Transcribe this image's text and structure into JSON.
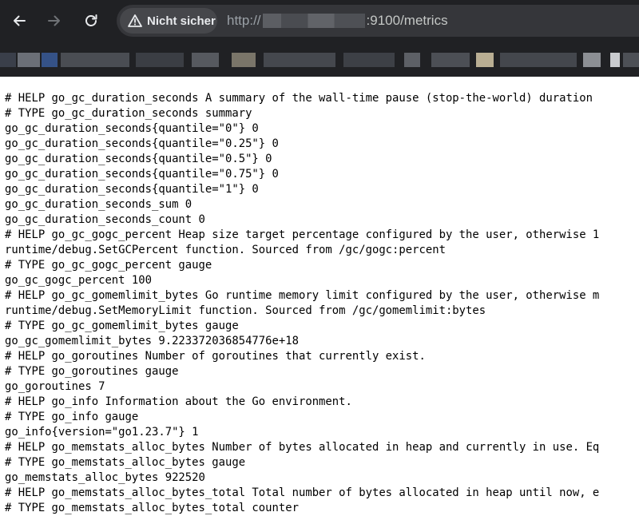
{
  "browser": {
    "security_label": "Nicht sicher",
    "url_scheme": "http://",
    "url_host": "",
    "url_path": ":9100/metrics",
    "icons": {
      "back": "arrow-left-icon",
      "forward": "arrow-right-icon",
      "reload": "reload-icon",
      "security": "warning-triangle-icon"
    }
  },
  "page": {
    "lines": [
      "# HELP go_gc_duration_seconds A summary of the wall-time pause (stop-the-world) duration",
      "# TYPE go_gc_duration_seconds summary",
      "go_gc_duration_seconds{quantile=\"0\"} 0",
      "go_gc_duration_seconds{quantile=\"0.25\"} 0",
      "go_gc_duration_seconds{quantile=\"0.5\"} 0",
      "go_gc_duration_seconds{quantile=\"0.75\"} 0",
      "go_gc_duration_seconds{quantile=\"1\"} 0",
      "go_gc_duration_seconds_sum 0",
      "go_gc_duration_seconds_count 0",
      "# HELP go_gc_gogc_percent Heap size target percentage configured by the user, otherwise 1",
      "runtime/debug.SetGCPercent function. Sourced from /gc/gogc:percent",
      "# TYPE go_gc_gogc_percent gauge",
      "go_gc_gogc_percent 100",
      "# HELP go_gc_gomemlimit_bytes Go runtime memory limit configured by the user, otherwise m",
      "runtime/debug.SetMemoryLimit function. Sourced from /gc/gomemlimit:bytes",
      "# TYPE go_gc_gomemlimit_bytes gauge",
      "go_gc_gomemlimit_bytes 9.223372036854776e+18",
      "# HELP go_goroutines Number of goroutines that currently exist.",
      "# TYPE go_goroutines gauge",
      "go_goroutines 7",
      "# HELP go_info Information about the Go environment.",
      "# TYPE go_info gauge",
      "go_info{version=\"go1.23.7\"} 1",
      "# HELP go_memstats_alloc_bytes Number of bytes allocated in heap and currently in use. Eq",
      "# TYPE go_memstats_alloc_bytes gauge",
      "go_memstats_alloc_bytes 922520",
      "# HELP go_memstats_alloc_bytes_total Total number of bytes allocated in heap until now, e",
      "# TYPE go_memstats_alloc_bytes_total counter"
    ]
  },
  "colors": {
    "chrome_bg": "#202124",
    "omnibox_bg": "#35363a",
    "chip_bg": "#46474b",
    "page_bg": "#ffffff",
    "text": "#000000"
  }
}
